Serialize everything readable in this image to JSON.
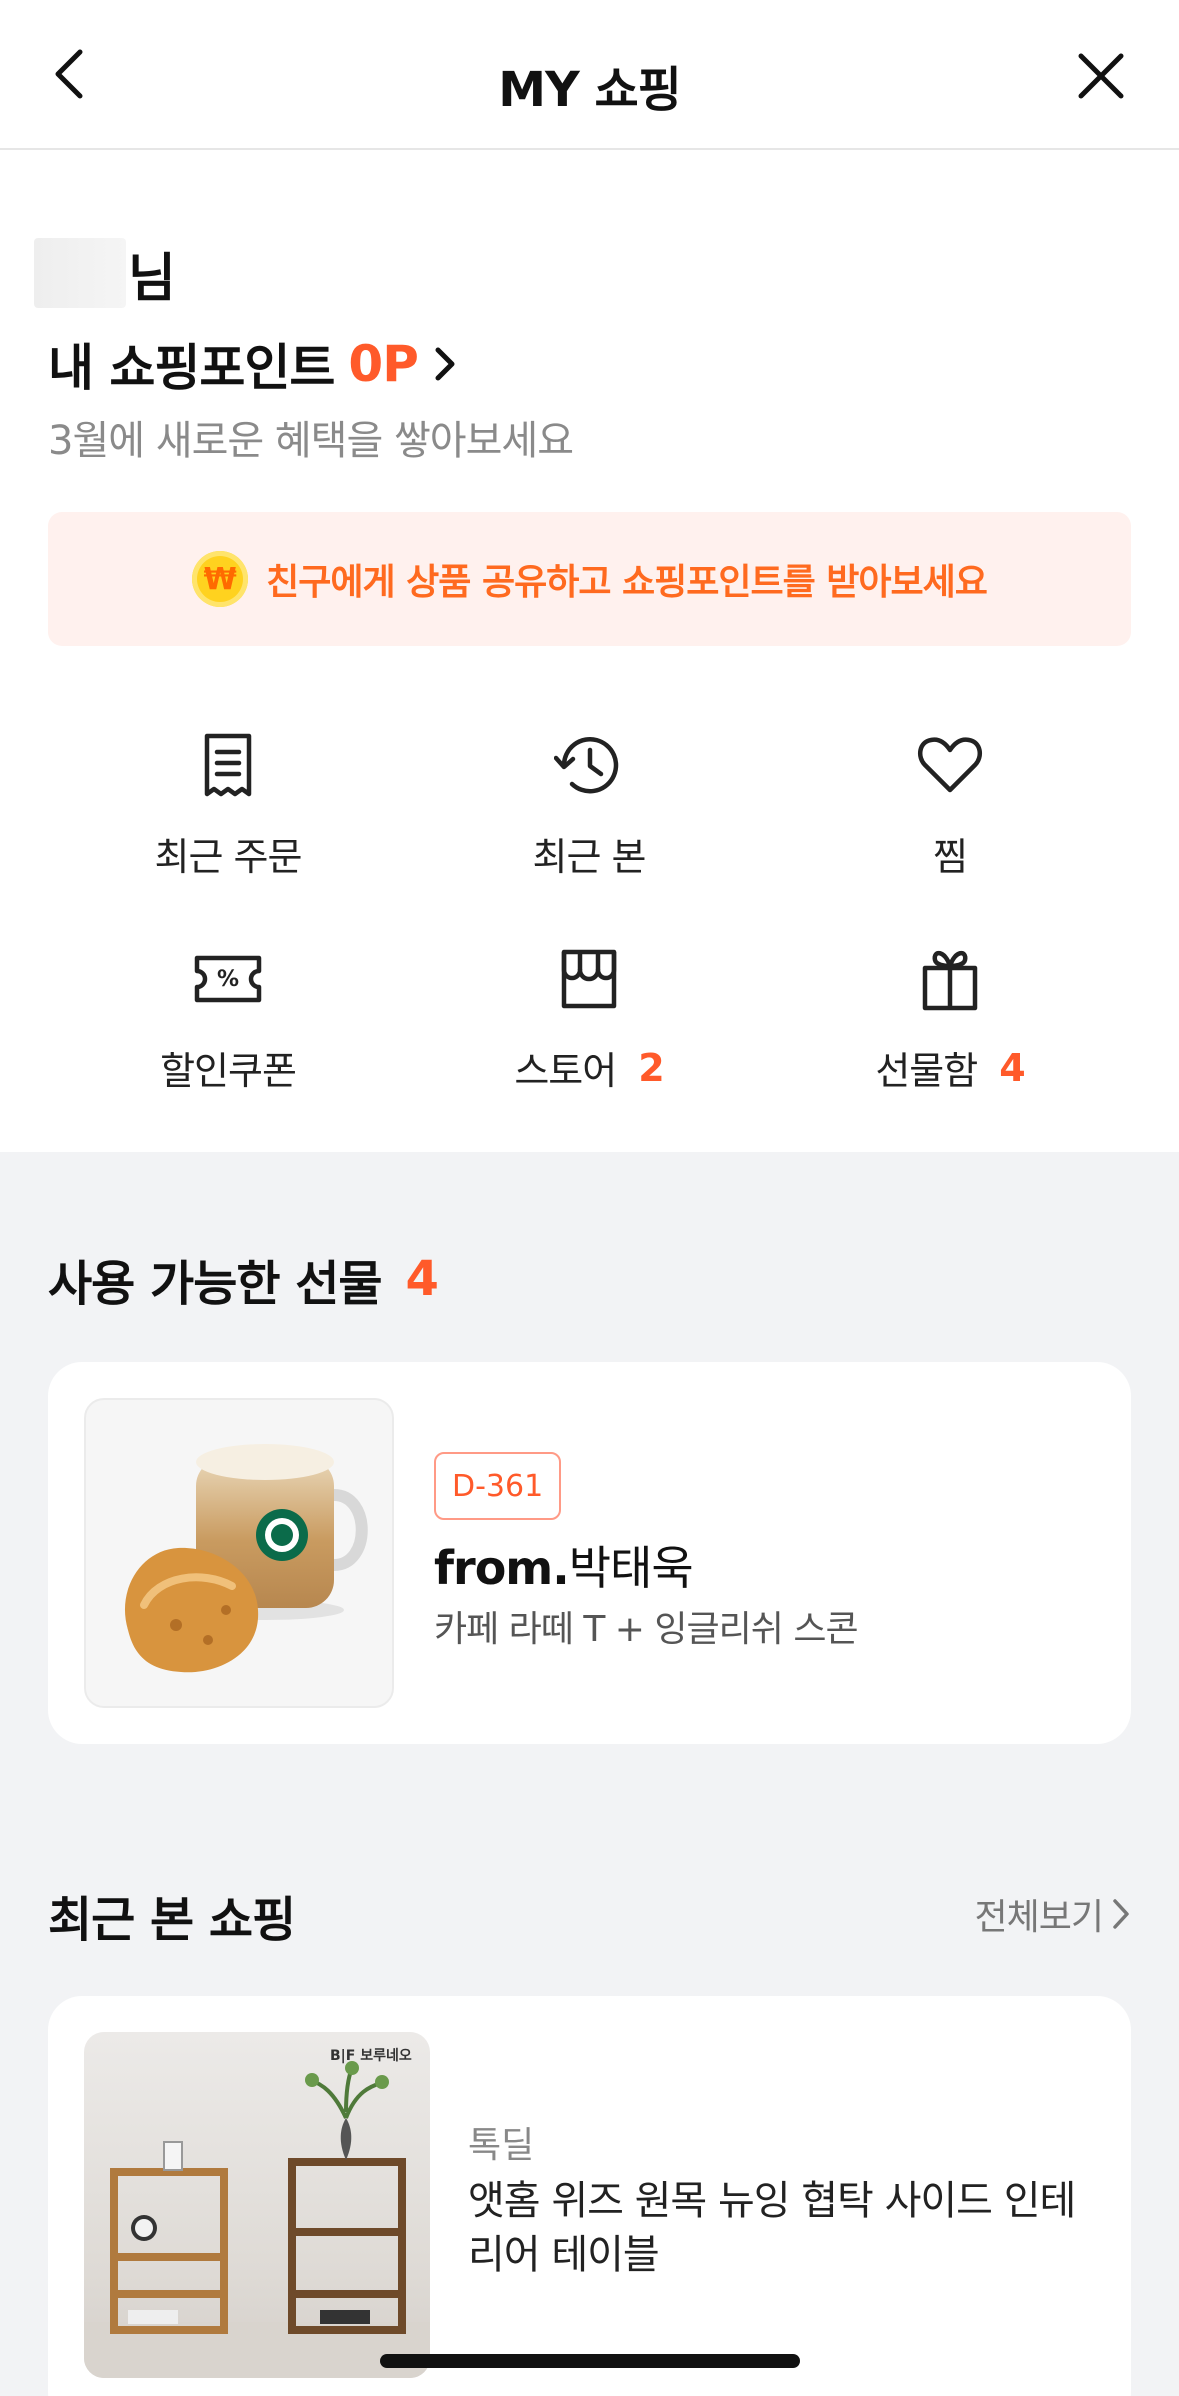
{
  "header": {
    "title": "MY 쇼핑"
  },
  "user": {
    "name_suffix": "님"
  },
  "points": {
    "label": "내 쇼핑포인트",
    "value": "0P",
    "subtitle": "3월에 새로운 혜택을 쌓아보세요"
  },
  "banner": {
    "coin_symbol": "₩",
    "text": "친구에게 상품 공유하고 쇼핑포인트를 받아보세요"
  },
  "menu": [
    {
      "label": "최근 주문",
      "icon": "receipt-icon",
      "count": ""
    },
    {
      "label": "최근 본",
      "icon": "history-icon",
      "count": ""
    },
    {
      "label": "찜",
      "icon": "heart-icon",
      "count": ""
    },
    {
      "label": "할인쿠폰",
      "icon": "coupon-icon",
      "count": ""
    },
    {
      "label": "스토어",
      "icon": "store-icon",
      "count": "2"
    },
    {
      "label": "선물함",
      "icon": "gift-icon",
      "count": "4"
    }
  ],
  "gifts": {
    "title": "사용 가능한 선물",
    "count": "4",
    "item": {
      "dday": "D-361",
      "from_prefix": "from.",
      "from_name": "박태욱",
      "desc": "카페 라떼 T + 잉글리쉬 스콘"
    }
  },
  "recent": {
    "title": "최근 본 쇼핑",
    "see_all": "전체보기",
    "item": {
      "brand_mark": "B|F 보루네오",
      "shop": "톡딜",
      "title": "앳홈 위즈 원목 뉴잉 협탁 사이드 인테리어 테이블"
    }
  },
  "colors": {
    "accent": "#ff5a2a",
    "banner_bg": "#fff1ee",
    "banner_text": "#ff6a1f",
    "page_bg": "#f2f3f5"
  }
}
